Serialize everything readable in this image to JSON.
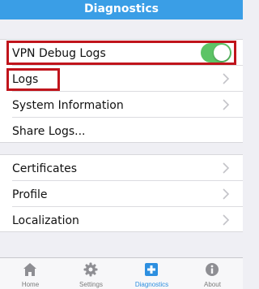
{
  "header": {
    "title": "Diagnostics"
  },
  "group1": [
    {
      "label": "VPN Debug Logs",
      "type": "toggle",
      "on": true
    },
    {
      "label": "Logs",
      "type": "nav"
    },
    {
      "label": "System Information",
      "type": "nav"
    },
    {
      "label": "Share Logs...",
      "type": "action"
    }
  ],
  "group2": [
    {
      "label": "Certificates",
      "type": "nav"
    },
    {
      "label": "Profile",
      "type": "nav"
    },
    {
      "label": "Localization",
      "type": "nav"
    }
  ],
  "tabs": [
    {
      "label": "Home",
      "icon": "home-icon",
      "active": false
    },
    {
      "label": "Settings",
      "icon": "gear-icon",
      "active": false
    },
    {
      "label": "Diagnostics",
      "icon": "plus-icon",
      "active": true
    },
    {
      "label": "About",
      "icon": "info-icon",
      "active": false
    }
  ],
  "colors": {
    "header": "#3a9ee6",
    "toggle_on": "#5cc466",
    "highlight": "#c0141c",
    "active_tab": "#2d8fe0"
  }
}
